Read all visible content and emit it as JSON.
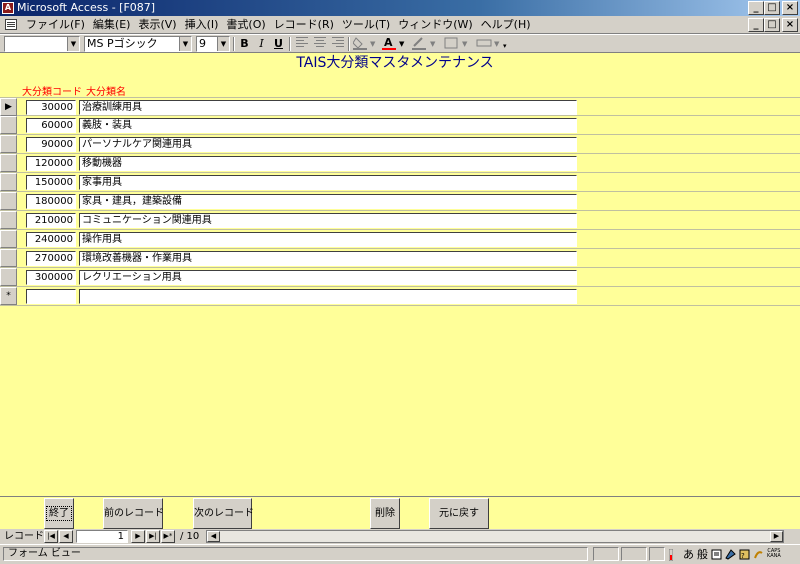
{
  "window": {
    "title": "Microsoft Access - [F087]",
    "controls": [
      "_",
      "□",
      "×"
    ]
  },
  "menu": {
    "items": [
      "ファイル(F)",
      "編集(E)",
      "表示(V)",
      "挿入(I)",
      "書式(O)",
      "レコード(R)",
      "ツール(T)",
      "ウィンドウ(W)",
      "ヘルプ(H)"
    ],
    "mdi_controls": [
      "_",
      "□",
      "×"
    ]
  },
  "toolbar": {
    "object_combo": "",
    "font_name": "MS Pゴシック",
    "font_size": "9",
    "bold": "B",
    "italic": "I",
    "underline": "U"
  },
  "form": {
    "title": "TAIS大分類マスタメンテナンス",
    "col_code": "大分類コード",
    "col_name": "大分類名",
    "records": [
      {
        "code": "30000",
        "name": "治療訓練用具",
        "current": true
      },
      {
        "code": "60000",
        "name": "義肢・装具",
        "current": false
      },
      {
        "code": "90000",
        "name": "パーソナルケア関連用具",
        "current": false
      },
      {
        "code": "120000",
        "name": "移動機器",
        "current": false
      },
      {
        "code": "150000",
        "name": "家事用具",
        "current": false
      },
      {
        "code": "180000",
        "name": "家具・建具，建築設備",
        "current": false
      },
      {
        "code": "210000",
        "name": "コミュニケーション関連用具",
        "current": false
      },
      {
        "code": "240000",
        "name": "操作用具",
        "current": false
      },
      {
        "code": "270000",
        "name": "環境改善機器・作業用具",
        "current": false
      },
      {
        "code": "300000",
        "name": "レクリエーション用具",
        "current": false
      }
    ],
    "new_row_marker": "*",
    "current_marker": "▶"
  },
  "buttons": {
    "close": "終了",
    "prev": "前のレコード",
    "next": "次のレコード",
    "delete": "削除",
    "undo": "元に戻す"
  },
  "navigation": {
    "label": "レコード:",
    "current": "1",
    "total": "/ 10",
    "first": "|◀",
    "prev": "◀",
    "next": "▶",
    "last": "▶|",
    "new": "▶*"
  },
  "status": {
    "text": "フォーム ビュー",
    "ime_mode": "あ",
    "ime_conv": "般",
    "caps": "CAPS",
    "kana": "KANA"
  },
  "colors": {
    "form_bg": "#ffff99",
    "header_text": "#ff0000",
    "title_text": "#00008b",
    "titlebar": "#0a246a"
  }
}
